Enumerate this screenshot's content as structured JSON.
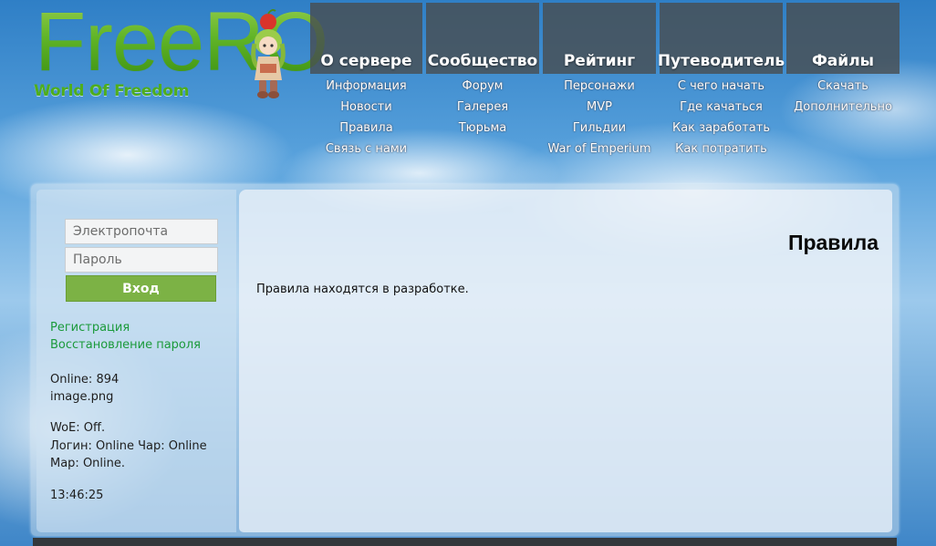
{
  "logo": {
    "title": "FreeRO",
    "subtitle": "World Of Freedom",
    "title_color": "#6cc531"
  },
  "nav": [
    {
      "label": "О сервере",
      "links": [
        "Информация",
        "Новости",
        "Правила",
        "Связь с нами"
      ]
    },
    {
      "label": "Сообщество",
      "links": [
        "Форум",
        "Галерея",
        "Тюрьма"
      ]
    },
    {
      "label": "Рейтинг",
      "links": [
        "Персонажи",
        "MVP",
        "Гильдии",
        "War of Emperium"
      ]
    },
    {
      "label": "Путеводитель",
      "links": [
        "С чего начать",
        "Где качаться",
        "Как заработать",
        "Как потратить"
      ]
    },
    {
      "label": "Файлы",
      "links": [
        "Скачать",
        "Дополнительно"
      ]
    }
  ],
  "login": {
    "email_placeholder": "Электропочта",
    "password_placeholder": "Пароль",
    "submit_label": "Вход",
    "button_color": "#7cb245"
  },
  "sidebar": {
    "register_link": "Регистрация",
    "recover_link": "Восстановление пароля",
    "online": "Online: 894",
    "image_text": "image.png",
    "woe": "WoE: Off.",
    "login_status": "Логин: Online Чар: Online",
    "map_status": "Map: Online.",
    "time": "13:46:25",
    "link_color": "#1b9a3b"
  },
  "content": {
    "title": "Правила",
    "body": "Правила находятся в разработке."
  }
}
